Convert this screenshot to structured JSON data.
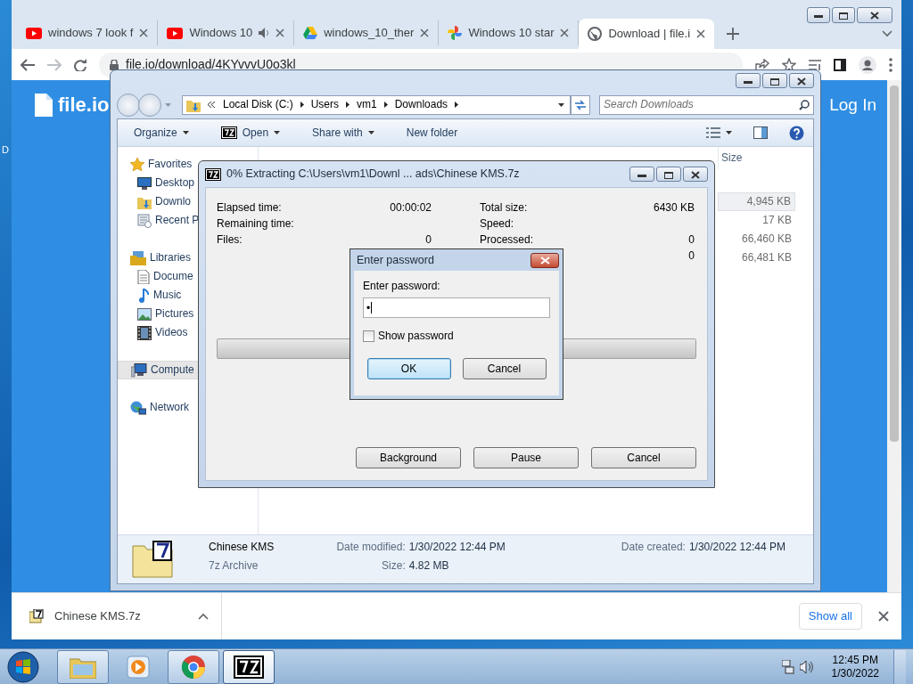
{
  "desktop": {
    "icon_label": "D"
  },
  "browser": {
    "tabs": [
      {
        "title": "windows 7 look f",
        "kind": "youtube",
        "audio": false,
        "selected": false
      },
      {
        "title": "Windows 10",
        "kind": "youtube",
        "audio": true,
        "selected": false
      },
      {
        "title": "windows_10_ther",
        "kind": "drive",
        "audio": false,
        "selected": false
      },
      {
        "title": "Windows 10 star",
        "kind": "photos",
        "audio": false,
        "selected": false
      },
      {
        "title": "Download | file.i",
        "kind": "globe",
        "audio": false,
        "selected": true
      }
    ],
    "url": "file.io/download/4KYvvvU0o3kl",
    "page": {
      "logo": "file.io",
      "login": "Log In"
    },
    "download": {
      "file": "Chinese KMS.7z",
      "show_all": "Show all"
    }
  },
  "explorer": {
    "address": [
      "Local Disk (C:)",
      "Users",
      "vm1",
      "Downloads"
    ],
    "search_placeholder": "Search Downloads",
    "commands": [
      {
        "label": "Organize",
        "kind": "plain",
        "dropdown": true
      },
      {
        "label": "Open",
        "kind": "archive",
        "dropdown": true
      },
      {
        "label": "Share with",
        "kind": "plain",
        "dropdown": true
      },
      {
        "label": "New folder",
        "kind": "plain",
        "dropdown": false
      }
    ],
    "nav": [
      {
        "label": "Favorites",
        "kind": "star",
        "selected": false,
        "children": [
          {
            "label": "Desktop",
            "kind": "desktop",
            "selected": false
          },
          {
            "label": "Downlo",
            "kind": "downloads",
            "selected": false
          },
          {
            "label": "Recent P",
            "kind": "recent",
            "selected": false
          }
        ]
      },
      {
        "label": "Libraries",
        "kind": "libraries",
        "selected": false,
        "children": [
          {
            "label": "Docume",
            "kind": "documents",
            "selected": false
          },
          {
            "label": "Music",
            "kind": "music",
            "selected": false
          },
          {
            "label": "Pictures",
            "kind": "pictures",
            "selected": false
          },
          {
            "label": "Videos",
            "kind": "videos",
            "selected": false
          }
        ]
      },
      {
        "label": "Compute",
        "kind": "computer",
        "selected": true
      },
      {
        "label": "Network",
        "kind": "network",
        "selected": false
      }
    ],
    "columns": [
      "Size"
    ],
    "sizes": [
      {
        "text": "4,945 KB",
        "selected": true
      },
      {
        "text": "17 KB",
        "selected": false
      },
      {
        "text": "66,460 KB",
        "selected": false
      },
      {
        "text": "66,481 KB",
        "selected": false
      }
    ],
    "details": {
      "name": "Chinese KMS",
      "type": "7z Archive",
      "fields": [
        {
          "label": "Date modified:",
          "value": "1/30/2022 12:44 PM"
        },
        {
          "label": "Size:",
          "value": "4.82 MB"
        },
        {
          "label": "Date created:",
          "value": "1/30/2022 12:44 PM"
        }
      ]
    }
  },
  "extract_dialog": {
    "title": "0% Extracting C:\\Users\\vm1\\Downl ... ads\\Chinese KMS.7z",
    "left": [
      {
        "label": "Elapsed time:",
        "value": "00:00:02"
      },
      {
        "label": "Remaining time:"
      },
      {
        "label": "Files:",
        "value": "0"
      }
    ],
    "right": [
      {
        "label": "Total size:",
        "value": "6430 KB"
      },
      {
        "label": "Speed:"
      },
      {
        "label": "Processed:",
        "value": "0"
      },
      {
        "value": "0"
      }
    ],
    "progress": {
      "level": 0
    },
    "buttons": [
      "Background",
      "Pause",
      "Cancel"
    ]
  },
  "password_dialog": {
    "title": "Enter password",
    "label": "Enter password:",
    "value": "•",
    "show_password": {
      "label": "Show password",
      "checked": false
    },
    "buttons": [
      {
        "label": "OK",
        "default": true
      },
      {
        "label": "Cancel",
        "default": false
      }
    ]
  },
  "taskbar": {
    "items": [
      {
        "kind": "explorer",
        "running": true,
        "selected": false
      },
      {
        "kind": "media",
        "running": false,
        "selected": false
      },
      {
        "kind": "chrome",
        "running": true,
        "selected": false
      },
      {
        "kind": "archive",
        "running": true,
        "selected": true
      }
    ],
    "time": "12:45 PM",
    "date": "1/30/2022"
  }
}
